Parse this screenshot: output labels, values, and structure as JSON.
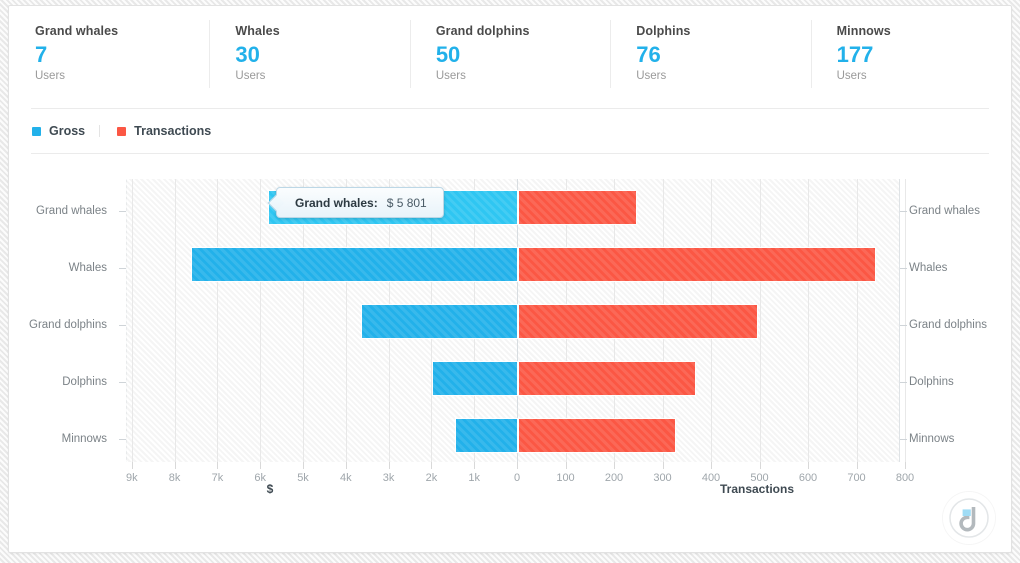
{
  "kpis": [
    {
      "title": "Grand whales",
      "value": "7",
      "unit": "Users"
    },
    {
      "title": "Whales",
      "value": "30",
      "unit": "Users"
    },
    {
      "title": "Grand dolphins",
      "value": "50",
      "unit": "Users"
    },
    {
      "title": "Dolphins",
      "value": "76",
      "unit": "Users"
    },
    {
      "title": "Minnows",
      "value": "177",
      "unit": "Users"
    }
  ],
  "legend": [
    {
      "label": "Gross",
      "color": "#22b1ea"
    },
    {
      "label": "Transactions",
      "color": "#fb5744"
    }
  ],
  "tooltip": {
    "label": "Grand whales:",
    "value": "$ 5 801"
  },
  "colors": {
    "gross": "#22b1ea",
    "gross_highlight": "#2fc6f2",
    "transactions": "#fb5744",
    "kpi_value": "#22b1ea",
    "grid": "#e8e8e8"
  },
  "logo": {
    "name": "brand-logo",
    "glyph": "d"
  },
  "chart_data": {
    "type": "bar",
    "orientation": "horizontal",
    "layout": "butterfly",
    "title": "",
    "categories": [
      "Grand whales",
      "Whales",
      "Grand dolphins",
      "Dolphins",
      "Minnows"
    ],
    "series": [
      {
        "name": "Gross",
        "axis": "left",
        "color": "#22b1ea",
        "unit": "$",
        "values": [
          5801,
          7600,
          3620,
          1960,
          1430
        ]
      },
      {
        "name": "Transactions",
        "axis": "right",
        "color": "#fb5744",
        "unit": "",
        "values": [
          241,
          734,
          490,
          363,
          322
        ]
      }
    ],
    "left_axis": {
      "label": "$",
      "ticks": [
        "9k",
        "8k",
        "7k",
        "6k",
        "5k",
        "4k",
        "3k",
        "2k",
        "1k",
        "0"
      ],
      "tick_values": [
        9000,
        8000,
        7000,
        6000,
        5000,
        4000,
        3000,
        2000,
        1000,
        0
      ],
      "min": 0,
      "max": 9000,
      "direction": "reversed"
    },
    "right_axis": {
      "label": "Transactions",
      "ticks": [
        "0",
        "100",
        "200",
        "300",
        "400",
        "500",
        "600",
        "700",
        "800"
      ],
      "tick_values": [
        0,
        100,
        200,
        300,
        400,
        500,
        600,
        700,
        800
      ],
      "min": 0,
      "max": 800,
      "direction": "normal"
    },
    "grid": true,
    "legend_position": "top-left"
  }
}
